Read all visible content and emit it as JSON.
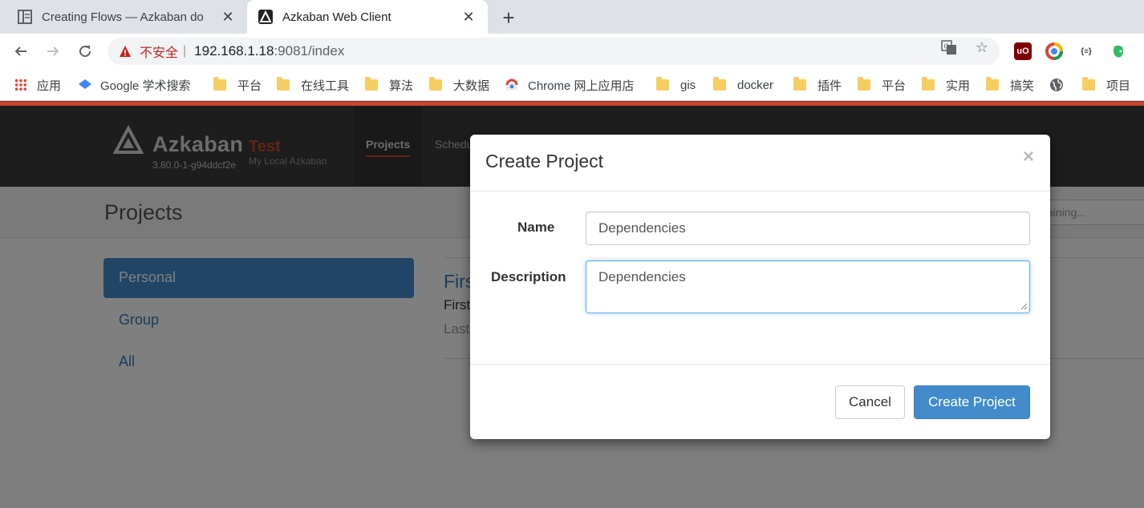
{
  "browser": {
    "tabs": [
      {
        "title": "Creating Flows — Azkaban do",
        "active": false,
        "icon": "docs-book-icon"
      },
      {
        "title": "Azkaban Web Client",
        "active": true,
        "icon": "azkaban-logo-icon"
      }
    ],
    "address": {
      "security_label": "不安全",
      "separator": "|",
      "host": "192.168.1.18",
      "rest": ":9081/index"
    },
    "bookmarks": [
      {
        "label": "应用",
        "icon": "apps-grid-icon"
      },
      {
        "label": "Google 学术搜索",
        "icon": "scholar-icon"
      },
      {
        "label": "平台",
        "icon": "folder-icon"
      },
      {
        "label": "在线工具",
        "icon": "folder-icon"
      },
      {
        "label": "算法",
        "icon": "folder-icon"
      },
      {
        "label": "大数据",
        "icon": "folder-icon"
      },
      {
        "label": "Chrome 网上应用店",
        "icon": "chrome-webstore-icon"
      },
      {
        "label": "gis",
        "icon": "folder-icon"
      },
      {
        "label": "docker",
        "icon": "folder-icon"
      },
      {
        "label": "插件",
        "icon": "folder-icon"
      },
      {
        "label": "平台",
        "icon": "folder-icon"
      },
      {
        "label": "实用",
        "icon": "folder-icon"
      },
      {
        "label": "搞笑",
        "icon": "folder-icon"
      },
      {
        "label": "",
        "icon": "globe-icon"
      },
      {
        "label": "项目",
        "icon": "folder-icon"
      }
    ],
    "accent_color": "#c6462e"
  },
  "azkaban": {
    "brand": "Azkaban",
    "env_name": "Test",
    "version": "3.80.0-1-g94ddcf2e",
    "env_description": "My Local Azkaban",
    "nav": [
      {
        "label": "Projects",
        "active": true
      },
      {
        "label": "Schedu",
        "active": false
      }
    ],
    "page_title": "Projects",
    "search_placeholder": "taining...",
    "sidebar": [
      {
        "label": "Personal",
        "active": true
      },
      {
        "label": "Group",
        "active": false
      },
      {
        "label": "All",
        "active": false
      }
    ],
    "project": {
      "name": "Firs",
      "description": "First",
      "meta": "Last"
    }
  },
  "modal": {
    "title": "Create Project",
    "close": "×",
    "fields": {
      "name_label": "Name",
      "name_value": "Dependencies",
      "description_label": "Description",
      "description_value": "Dependencies"
    },
    "buttons": {
      "cancel": "Cancel",
      "create": "Create Project"
    }
  }
}
